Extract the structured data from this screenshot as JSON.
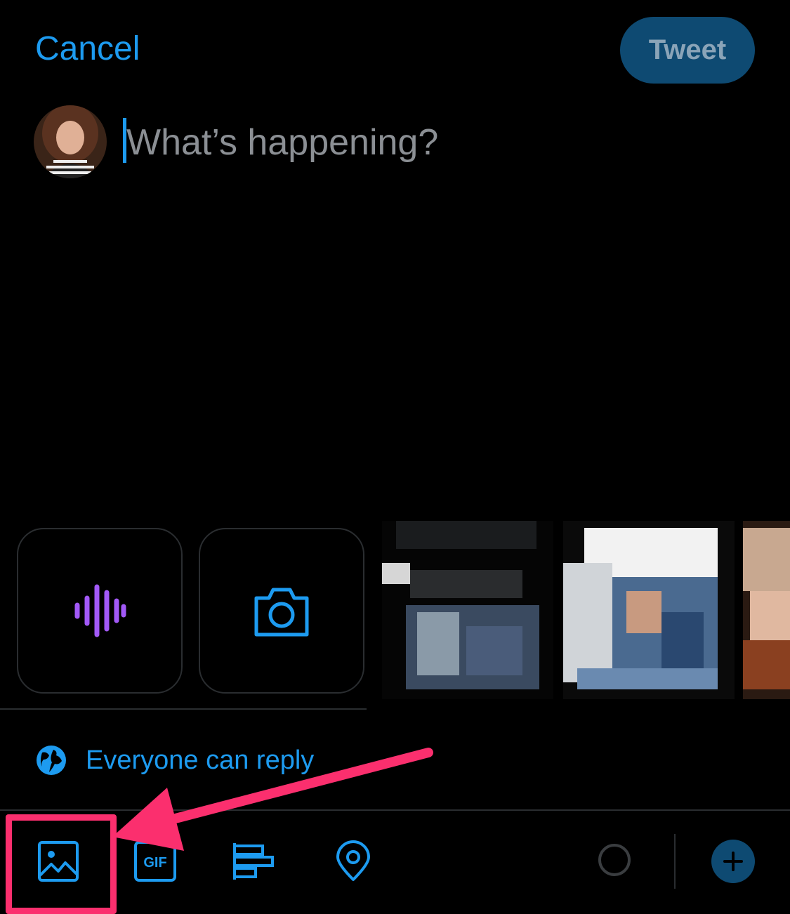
{
  "header": {
    "cancel_label": "Cancel",
    "tweet_label": "Tweet"
  },
  "compose": {
    "placeholder": "What’s happening?"
  },
  "media": {
    "voice_icon": "voice-waveform-icon",
    "camera_icon": "camera-icon"
  },
  "reply_setting": {
    "label": "Everyone can reply",
    "icon": "globe-icon"
  },
  "toolbar": {
    "items": [
      "image-icon",
      "gif-icon",
      "poll-icon",
      "location-icon"
    ],
    "gif_text": "GIF"
  },
  "colors": {
    "accent": "#1d9bf0",
    "tweet_button_bg": "#0e4a72",
    "voice_purple": "#a259f7",
    "annotation": "#fb2f6e",
    "background": "#000000"
  }
}
